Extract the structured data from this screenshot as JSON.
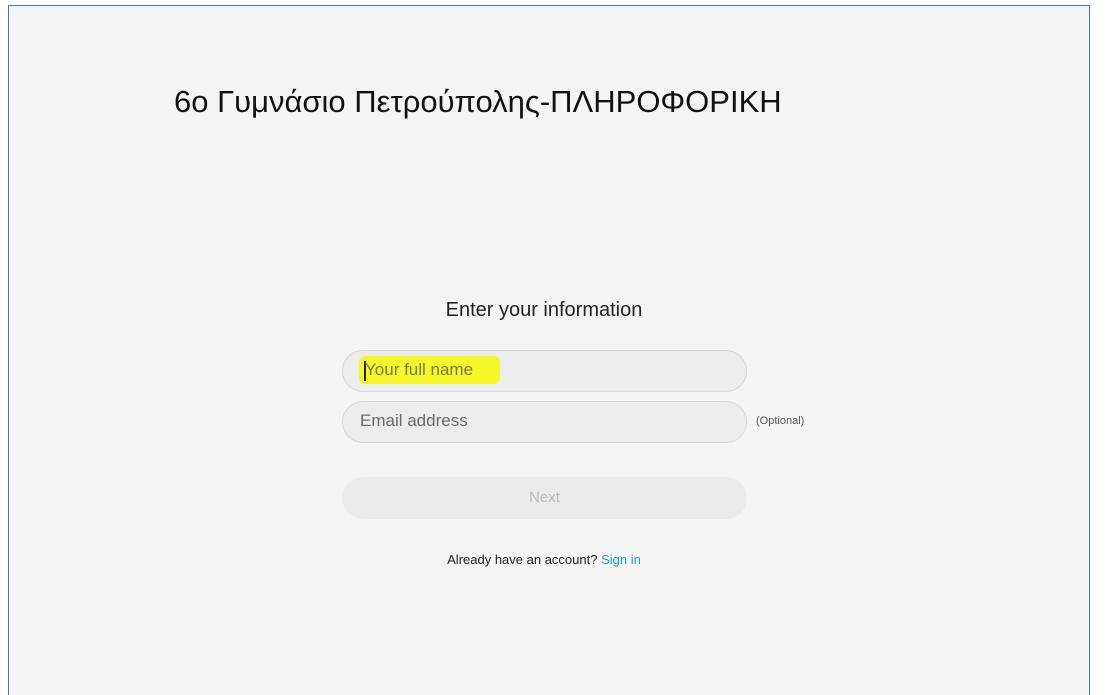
{
  "page": {
    "title": "6ο Γυμνάσιο Πετρούπολης-ΠΛΗΡΟΦΟΡΙΚΗ"
  },
  "form": {
    "heading": "Enter your information",
    "name_placeholder": "Your full name",
    "email_placeholder": "Email address",
    "email_optional_label": "(Optional)",
    "next_label": "Next",
    "account_prompt": "Already have an account?",
    "signin_label": "Sign in"
  },
  "colors": {
    "background": "#f4f4f4",
    "frame_border": "#4472c4",
    "highlight": "#f5f72a",
    "link": "#1a9bd7"
  }
}
